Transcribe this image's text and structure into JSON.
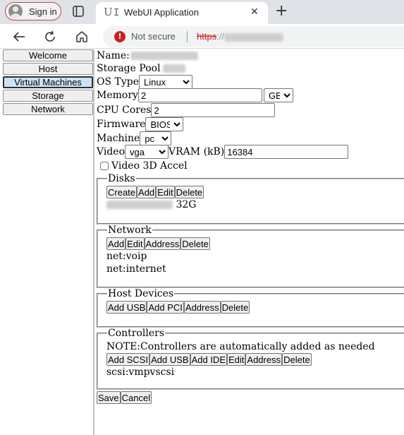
{
  "browser": {
    "signin_label": "Sign in",
    "tab_title": "WebUI Application",
    "not_secure_label": "Not secure",
    "url_scheme": "https",
    "url_rest": "://"
  },
  "sidebar": {
    "items": [
      {
        "label": "Welcome"
      },
      {
        "label": "Host"
      },
      {
        "label": "Virtual Machines",
        "selected": true
      },
      {
        "label": "Storage"
      },
      {
        "label": "Network"
      }
    ]
  },
  "vm": {
    "name_label": "Name:",
    "storage_pool_label": "Storage Pool",
    "os_type_label": "OS Type",
    "os_type_value": "Linux",
    "memory_label": "Memory",
    "memory_value": "2",
    "memory_unit": "GB",
    "cpu_label": "CPU Cores",
    "cpu_value": "2",
    "firmware_label": "Firmware",
    "firmware_value": "BIOS",
    "machine_label": "Machine",
    "machine_value": "pc",
    "video_label": "Video",
    "video_value": "vga",
    "vram_label": "VRAM (kB)",
    "vram_value": "16384",
    "video3d_label": "Video 3D Accel",
    "video3d_checked": false
  },
  "disks": {
    "legend": "Disks",
    "buttons": {
      "create": "Create",
      "add": "Add",
      "edit": "Edit",
      "delete": "Delete"
    },
    "disk_size": "32G"
  },
  "network": {
    "legend": "Network",
    "buttons": {
      "add": "Add",
      "edit": "Edit",
      "address": "Address",
      "delete": "Delete"
    },
    "items": [
      "net:voip",
      "net:internet"
    ]
  },
  "host_devices": {
    "legend": "Host Devices",
    "buttons": {
      "add_usb": "Add USB",
      "add_pci": "Add PCI",
      "address": "Address",
      "delete": "Delete"
    }
  },
  "controllers": {
    "legend": "Controllers",
    "note": "NOTE:Controllers are automatically added as needed",
    "buttons": {
      "add_scsi": "Add SCSI",
      "add_usb": "Add USB",
      "add_ide": "Add IDE",
      "edit": "Edit",
      "address": "Address",
      "delete": "Delete"
    },
    "items": [
      "scsi:vmpvscsi"
    ]
  },
  "actions": {
    "save": "Save",
    "cancel": "Cancel"
  },
  "colors": {
    "accent_selected": "#cce3f5",
    "insecure_red": "#c5221f"
  }
}
